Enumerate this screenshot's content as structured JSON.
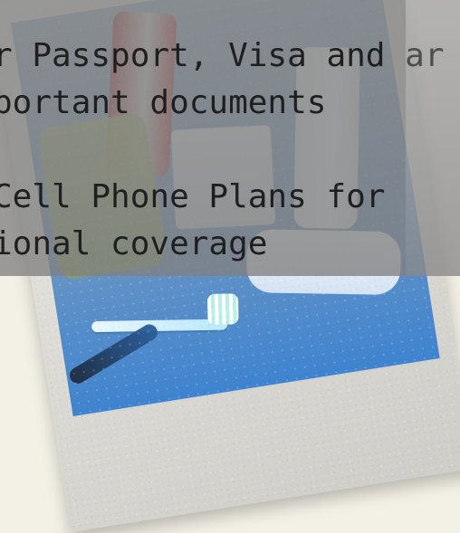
{
  "banner": {
    "line1": "r Passport, Visa and ar",
    "line2": "portant documents",
    "line3": " Cell Phone Plans for",
    "line4": "ional coverage"
  },
  "photo": {
    "items": [
      "toothpaste",
      "towel",
      "box",
      "bottle",
      "soap-case",
      "toothbrush",
      "razor"
    ]
  },
  "colors": {
    "page_bg": "#f3f0e6",
    "banner_bg": "rgba(128,128,128,0.78)",
    "text": "#1f1f1f"
  }
}
